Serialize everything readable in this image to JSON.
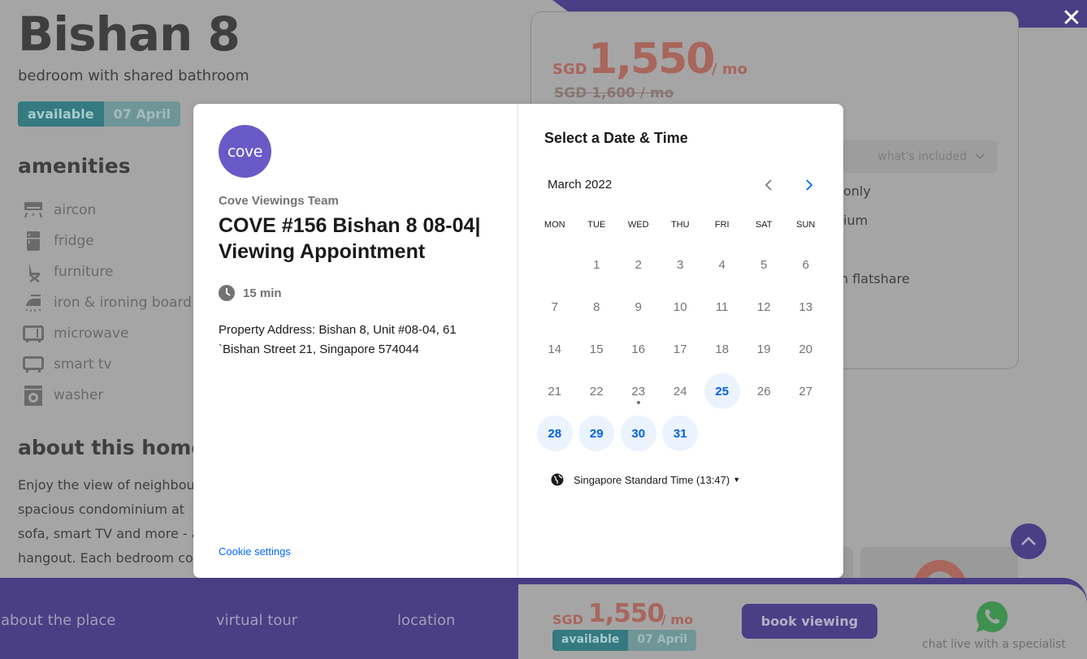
{
  "listing": {
    "title": "Bishan 8",
    "subtitle": "bedroom with shared bathroom",
    "availability": {
      "status": "available",
      "date": "07 April"
    },
    "amenities_heading": "amenities",
    "amenities": [
      {
        "label": "aircon",
        "icon": "aircon-icon"
      },
      {
        "label": "fridge",
        "icon": "fridge-icon"
      },
      {
        "label": "furniture",
        "icon": "chair-icon"
      },
      {
        "label": "iron & ironing board",
        "icon": "iron-icon"
      },
      {
        "label": "microwave",
        "icon": "microwave-icon"
      },
      {
        "label": "smart tv",
        "icon": "tv-icon"
      },
      {
        "label": "washer",
        "icon": "washer-icon"
      }
    ],
    "about_heading": "about this home",
    "about_lines": [
      "Enjoy the view of neighbou",
      "spacious condominium at",
      "sofa, smart TV and more - a",
      "hangout. Each bedroom co"
    ]
  },
  "price_card": {
    "currency": "SGD",
    "amount": "1,550",
    "period": "/ mo",
    "old_price": "SGD 1,600 / mo",
    "whats_included": "what's included",
    "features_partial": [
      "only",
      "ium",
      "h flatshare"
    ]
  },
  "bottom_bar": {
    "nav": [
      "about the place",
      "virtual tour",
      "location"
    ],
    "currency": "SGD",
    "amount": "1,550",
    "period": "/ mo",
    "availability": {
      "status": "available",
      "date": "07 April"
    },
    "book_label": "book viewing",
    "chat_label": "chat live with a specialist"
  },
  "modal": {
    "logo_text": "cove",
    "host": "Cove Viewings Team",
    "event_title": "COVE #156 Bishan 8 08-04| Viewing Appointment",
    "duration": "15 min",
    "address": "Property Address: Bishan 8, Unit #08-04, 61 `Bishan Street 21, Singapore 574044",
    "cookie_settings": "Cookie settings",
    "select_title": "Select a Date & Time",
    "month": "March 2022",
    "weekdays": [
      "MON",
      "TUE",
      "WED",
      "THU",
      "FRI",
      "SAT",
      "SUN"
    ],
    "first_weekday_offset": 1,
    "days_in_month": 31,
    "today": 23,
    "available_days": [
      25,
      28,
      29,
      30,
      31
    ],
    "timezone": "Singapore Standard Time (13:47)"
  },
  "colors": {
    "brand_purple": "#4a3e85",
    "logo_purple": "#6a5ac7",
    "calendar_blue": "#0069ff",
    "price_red": "#a8665c",
    "whatsapp_green": "#3f9150"
  }
}
